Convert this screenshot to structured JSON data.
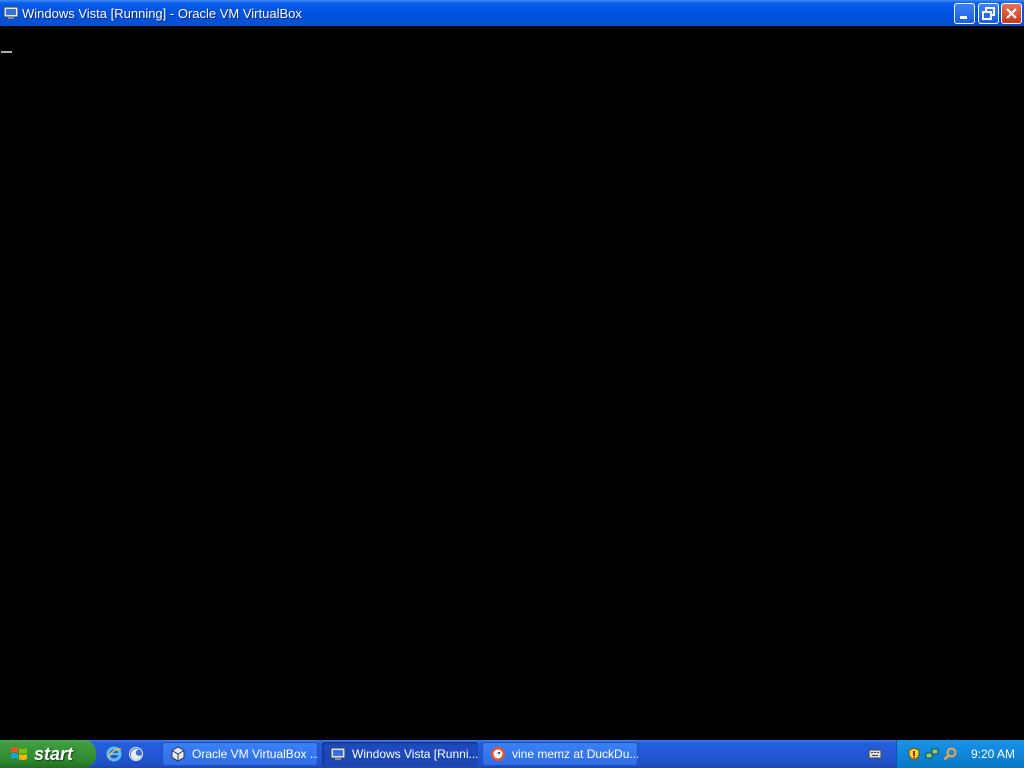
{
  "window": {
    "title": "Windows Vista [Running] - Oracle VM VirtualBox",
    "icon": "virtualbox-vm-icon"
  },
  "taskbar": {
    "start_label": "start",
    "quick_launch": [
      {
        "icon": "internet-explorer-icon"
      },
      {
        "icon": "firefox-icon"
      }
    ],
    "tasks": [
      {
        "label": "Oracle VM VirtualBox ...",
        "icon": "virtualbox-icon",
        "active": false
      },
      {
        "label": "Windows Vista [Runni...",
        "icon": "virtualbox-vm-icon",
        "active": true
      },
      {
        "label": "vine memz at DuckDu...",
        "icon": "duckduckgo-icon",
        "active": false
      }
    ],
    "tray": {
      "icons": [
        "security-shield-icon",
        "network-icon",
        "search-icon"
      ],
      "clock": "9:20 AM"
    }
  },
  "colors": {
    "titlebar": "#0054e3",
    "taskbar": "#245edb",
    "start": "#3c9a3c",
    "tray": "#0f86d8",
    "vm_background": "#000000"
  }
}
